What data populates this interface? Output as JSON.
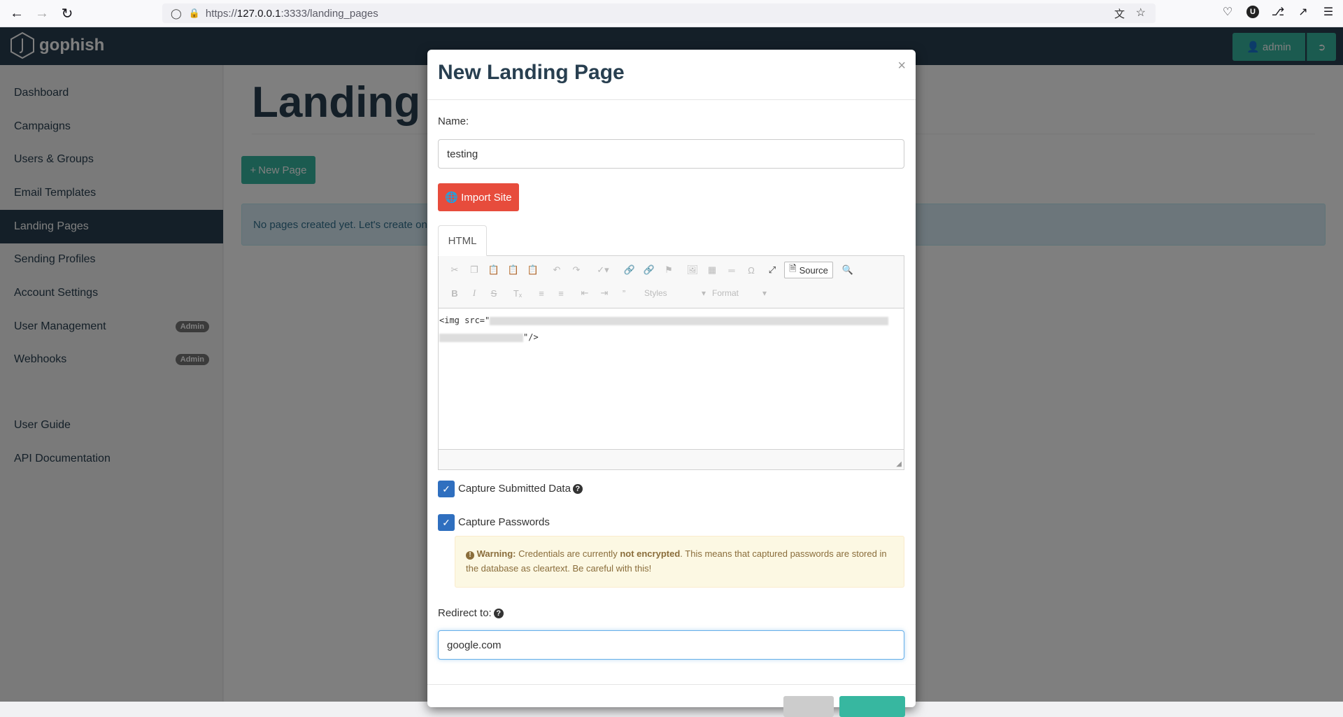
{
  "browser": {
    "url_prefix": "https://",
    "url_host": "127.0.0.1",
    "url_rest": ":3333/landing_pages"
  },
  "navbar": {
    "brand": "gophish",
    "user": "admin"
  },
  "sidebar": {
    "items": [
      {
        "label": "Dashboard"
      },
      {
        "label": "Campaigns"
      },
      {
        "label": "Users & Groups"
      },
      {
        "label": "Email Templates"
      },
      {
        "label": "Landing Pages"
      },
      {
        "label": "Sending Profiles"
      },
      {
        "label": "Account Settings"
      },
      {
        "label": "User Management",
        "badge": "Admin"
      },
      {
        "label": "Webhooks",
        "badge": "Admin"
      },
      {
        "label": "User Guide"
      },
      {
        "label": "API Documentation"
      }
    ]
  },
  "main": {
    "title": "Landing Pages",
    "new_button": "New Page",
    "alert": "No pages created yet. Let's create one!"
  },
  "modal": {
    "title": "New Landing Page",
    "close": "×",
    "name_label": "Name:",
    "name_value": "testing",
    "import_button": "Import Site",
    "tab_html": "HTML",
    "source_button": "Source",
    "styles_combo": "Styles",
    "format_combo": "Format",
    "code_start": "<img src=\"",
    "code_end": "\"/>",
    "capture_data_label": "Capture Submitted Data",
    "capture_passwords_label": "Capture Passwords",
    "warning_strong": "Warning:",
    "warning_text_1": " Credentials are currently ",
    "warning_bold": "not encrypted",
    "warning_text_2": ". This means that captured passwords are stored in the database as cleartext. Be careful with this!",
    "redirect_label": "Redirect to:",
    "redirect_value": "google.com"
  },
  "colors": {
    "navbar": "#283f50",
    "accent": "#37b7a0",
    "danger": "#e74c3c",
    "checkbox": "#2f6fbf"
  }
}
